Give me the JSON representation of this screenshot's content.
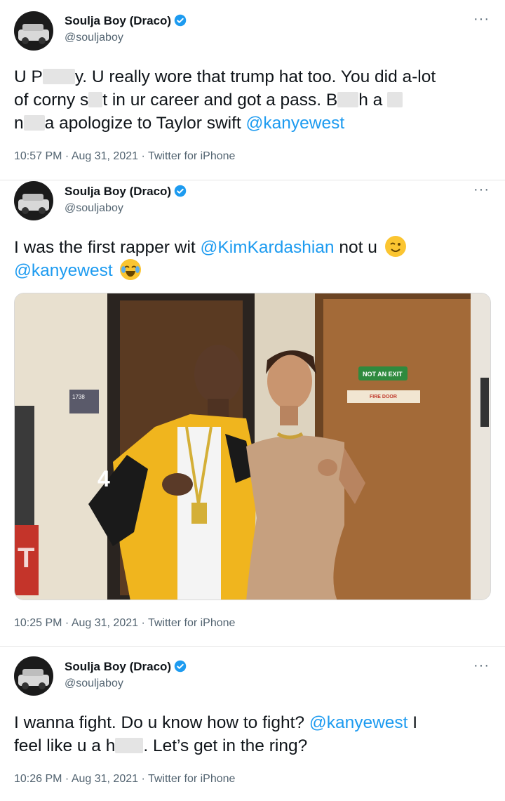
{
  "tweets": [
    {
      "name": "Soulja Boy (Draco)",
      "handle": "@souljaboy",
      "more": "···",
      "segments": {
        "a": "U P",
        "b": "y. U really wore that trump hat too. You did a-lot",
        "c": "of corny s",
        "d": "t in ur career and got a pass. B",
        "e": "h a",
        "f": "n",
        "g": "a apologize to Taylor swift ",
        "mention": "@kanyewest"
      },
      "meta": "10:57 PM · Aug 31, 2021 · Twitter for iPhone"
    },
    {
      "name": "Soulja Boy (Draco)",
      "handle": "@souljaboy",
      "more": "···",
      "segments": {
        "a": "I was the first rapper wit ",
        "mention1": "@KimKardashian",
        "b": " not u",
        "mention2": "@kanyewest"
      },
      "emojis": [
        "winking-face",
        "tears-of-joy"
      ],
      "photo_signs": {
        "exit": "NOT AN EXIT",
        "fire": "FIRE DOOR",
        "room": "1738",
        "jacket": "4"
      },
      "meta": "10:25 PM · Aug 31, 2021 · Twitter for iPhone"
    },
    {
      "name": "Soulja Boy (Draco)",
      "handle": "@souljaboy",
      "more": "···",
      "segments": {
        "a": "I wanna fight. Do u know how to fight? ",
        "mention": "@kanyewest",
        "b": " I",
        "c": "feel like u a h",
        "d": ". Let’s get in the ring?"
      },
      "meta": "10:26 PM · Aug 31, 2021 · Twitter for iPhone"
    }
  ],
  "colors": {
    "link": "#1d9bf0",
    "verified": "#1d9bf0",
    "secondary": "#536471"
  }
}
